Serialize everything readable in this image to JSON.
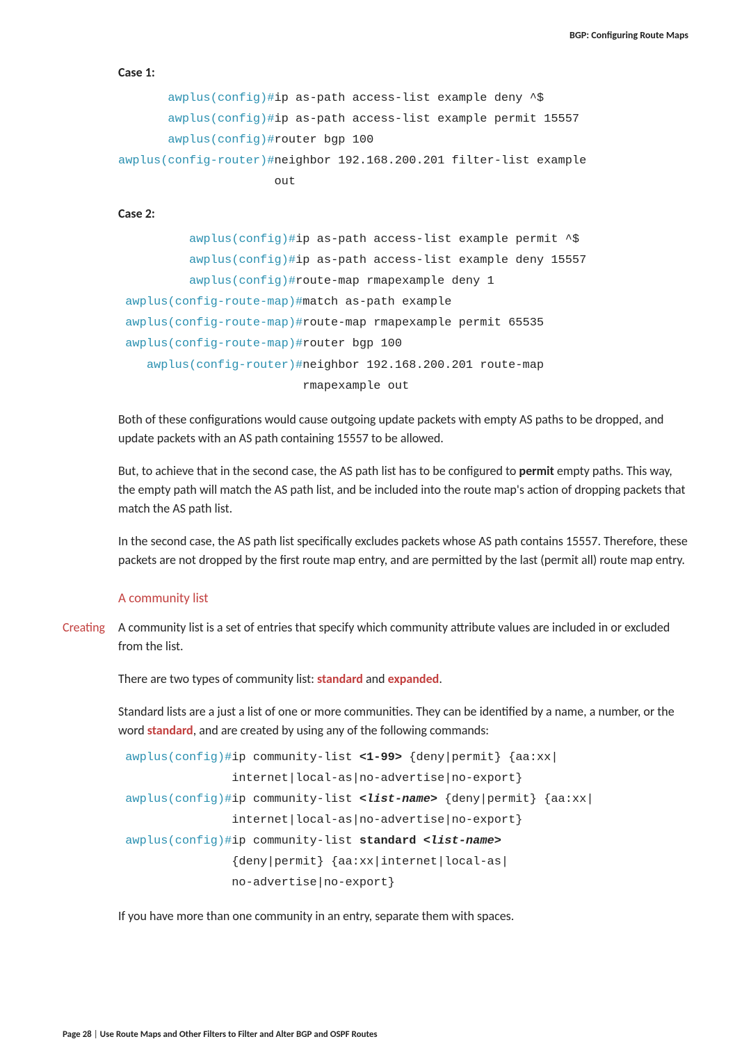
{
  "header": {
    "title": "BGP: Configuring Route Maps"
  },
  "case1": {
    "heading": "Case 1:",
    "lines": [
      {
        "prompt": "awplus(config)#",
        "cmd": "ip as-path access-list example deny ^$"
      },
      {
        "prompt": "awplus(config)#",
        "cmd": "ip as-path access-list example permit 15557"
      },
      {
        "prompt": "awplus(config)#",
        "cmd": "router bgp 100"
      },
      {
        "prompt": "awplus(config-router)#",
        "cmd": "neighbor 192.168.200.201 filter-list example"
      },
      {
        "prompt": "",
        "cmd": "out"
      }
    ]
  },
  "case2": {
    "heading": "Case 2:",
    "lines": [
      {
        "prompt": "awplus(config)#",
        "cmd": "ip as-path access-list example permit ^$"
      },
      {
        "prompt": "awplus(config)#",
        "cmd": "ip as-path access-list example deny 15557"
      },
      {
        "prompt": "awplus(config)#",
        "cmd": "route-map rmapexample deny 1"
      },
      {
        "prompt": "awplus(config-route-map)#",
        "cmd": "match as-path example"
      },
      {
        "prompt": "awplus(config-route-map)#",
        "cmd": "route-map rmapexample permit 65535"
      },
      {
        "prompt": "awplus(config-route-map)#",
        "cmd": "router bgp 100"
      },
      {
        "prompt": "awplus(config-router)#",
        "cmd": "neighbor 192.168.200.201 route-map"
      },
      {
        "prompt": "",
        "cmd": "rmapexample out"
      }
    ]
  },
  "para1": "Both of these configurations would cause outgoing update packets with empty AS paths to be dropped, and update packets with an AS path containing 15557 to be allowed.",
  "para2a": "But, to achieve that in the second case, the AS path list has to be configured to ",
  "para2b": "permit",
  "para2c": " empty paths. This way, the empty path will match the AS path list, and be included into the route map's action of dropping packets that match the AS path list.",
  "para3": "In the second case, the AS path list specifically excludes packets whose AS path contains 15557. Therefore, these packets are not dropped by the first route map entry, and are permitted by the last (permit all) route map entry.",
  "section": {
    "heading": "A community list"
  },
  "creating": {
    "label": "Creating",
    "para1": "A community list is a set of entries that specify which community attribute values are included in or excluded from the list.",
    "para2a": "There are two types of community list: ",
    "para2_standard": "standard",
    "para2_and": " and ",
    "para2_expanded": "expanded",
    "para2_dot": ".",
    "para3a": "Standard lists are a just a list of one or more communities. They can be identified by a name, a number, or the word ",
    "para3_standard": "standard",
    "para3b": ", and are created by using any of the following commands:"
  },
  "cmds3": {
    "l1": {
      "prompt": "awplus(config)#",
      "a": "ip community-list ",
      "b": "<1-99>",
      "c": " {deny|permit} {aa:xx|"
    },
    "l2": "internet|local-as|no-advertise|no-export}",
    "l3": {
      "prompt": "awplus(config)#",
      "a": "ip community-list ",
      "b": "<list-name>",
      "c": " {deny|permit} {aa:xx|"
    },
    "l4": "internet|local-as|no-advertise|no-export}",
    "l5": {
      "prompt": "awplus(config)#",
      "a": "ip community-list ",
      "b": "standard",
      "c": " ",
      "d": "<list-name>"
    },
    "l6": "{deny|permit} {aa:xx|internet|local-as|",
    "l7": "no-advertise|no-export}"
  },
  "para_last": "If you have more than one community in an entry, separate them with spaces.",
  "footer": {
    "pagelabel": "Page ",
    "pagenum": "28",
    "sep": " |  ",
    "title": "Use Route Maps and Other Filters to Filter and Alter BGP and OSPF Routes"
  }
}
